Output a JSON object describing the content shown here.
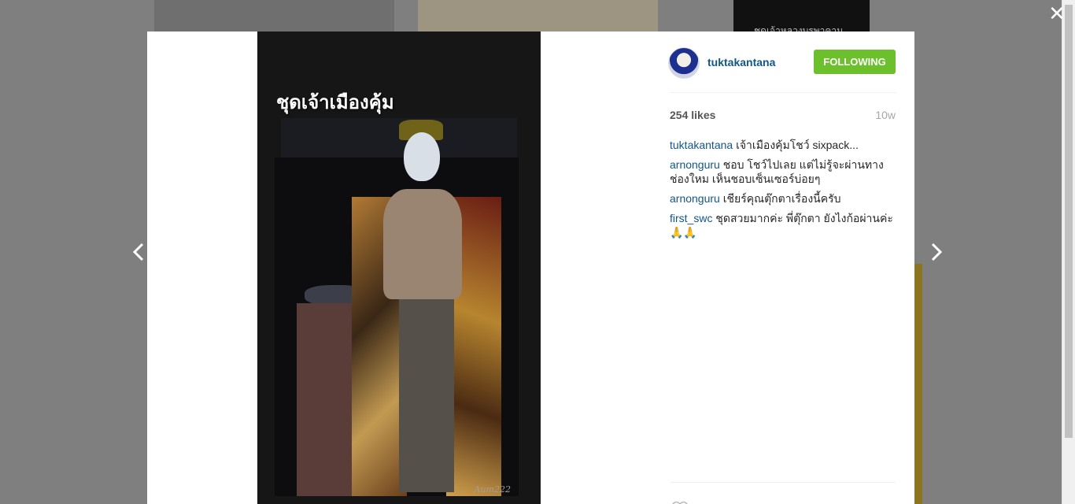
{
  "background": {
    "tile_text": "ชุดเจ้าหลวงบรพาคาม"
  },
  "post": {
    "image_title": "ชุดเจ้าเมืองคุ้ม",
    "image_signature": "Aum222",
    "user": {
      "username": "tuktakantana"
    },
    "follow_label": "FOLLOWING",
    "likes": "254 likes",
    "time_ago": "10w",
    "comments": [
      {
        "author": "tuktakantana",
        "text": "เจ้าเมืองคุ้มโชว์ sixpack..."
      },
      {
        "author": "arnonguru",
        "text": "ชอบ โชว์ไปเลย แต่ไม่รู้จะผ่านทางช่องใหม เห็นชอบเซ็นเซอร์บ่อยๆ"
      },
      {
        "author": "arnonguru",
        "text": "เชียร์คุณตุ๊กตาเรื่องนี้ครับ"
      },
      {
        "author": "first_swc",
        "text": "ชุดสวยมากค่ะ พี่ตุ๊กตา ยังไงก้อผ่านค่ะ 🙏🙏"
      }
    ]
  },
  "controls": {
    "close_glyph": "✕"
  },
  "colors": {
    "follow_button": "#6bc02b",
    "username_link": "#125688"
  }
}
